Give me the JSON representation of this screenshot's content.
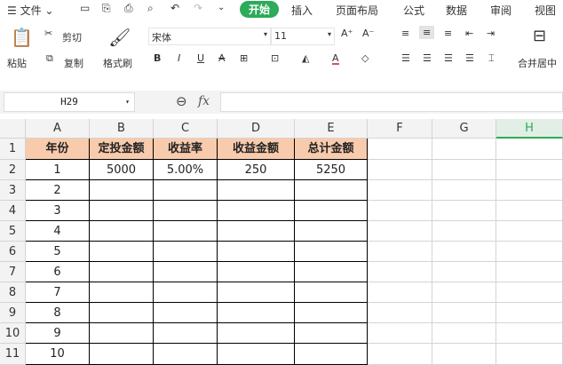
{
  "menu": {
    "file": "文件",
    "tabs": [
      "开始",
      "插入",
      "页面布局",
      "公式",
      "数据",
      "审阅",
      "视图"
    ]
  },
  "ribbon": {
    "paste": "粘贴",
    "cut": "剪切",
    "copy": "复制",
    "format_painter": "格式刷",
    "font": "宋体",
    "size": "11",
    "merge": "合并居中"
  },
  "formula_bar": {
    "name_box": "H29",
    "fx": "fx",
    "value": ""
  },
  "sheet": {
    "columns": [
      "A",
      "B",
      "C",
      "D",
      "E",
      "F",
      "G",
      "H"
    ],
    "rows": [
      "1",
      "2",
      "3",
      "4",
      "5",
      "6",
      "7",
      "8",
      "9",
      "10",
      "11"
    ],
    "header_fill": "#f8cbad",
    "cells": [
      [
        "年份",
        "定投金额",
        "收益率",
        "收益金额",
        "总计金额"
      ],
      [
        "1",
        "5000",
        "5.00%",
        "250",
        "5250"
      ],
      [
        "2",
        "",
        "",
        "",
        ""
      ],
      [
        "3",
        "",
        "",
        "",
        ""
      ],
      [
        "4",
        "",
        "",
        "",
        ""
      ],
      [
        "5",
        "",
        "",
        "",
        ""
      ],
      [
        "6",
        "",
        "",
        "",
        ""
      ],
      [
        "7",
        "",
        "",
        "",
        ""
      ],
      [
        "8",
        "",
        "",
        "",
        ""
      ],
      [
        "9",
        "",
        "",
        "",
        ""
      ],
      [
        "10",
        "",
        "",
        "",
        ""
      ]
    ]
  }
}
